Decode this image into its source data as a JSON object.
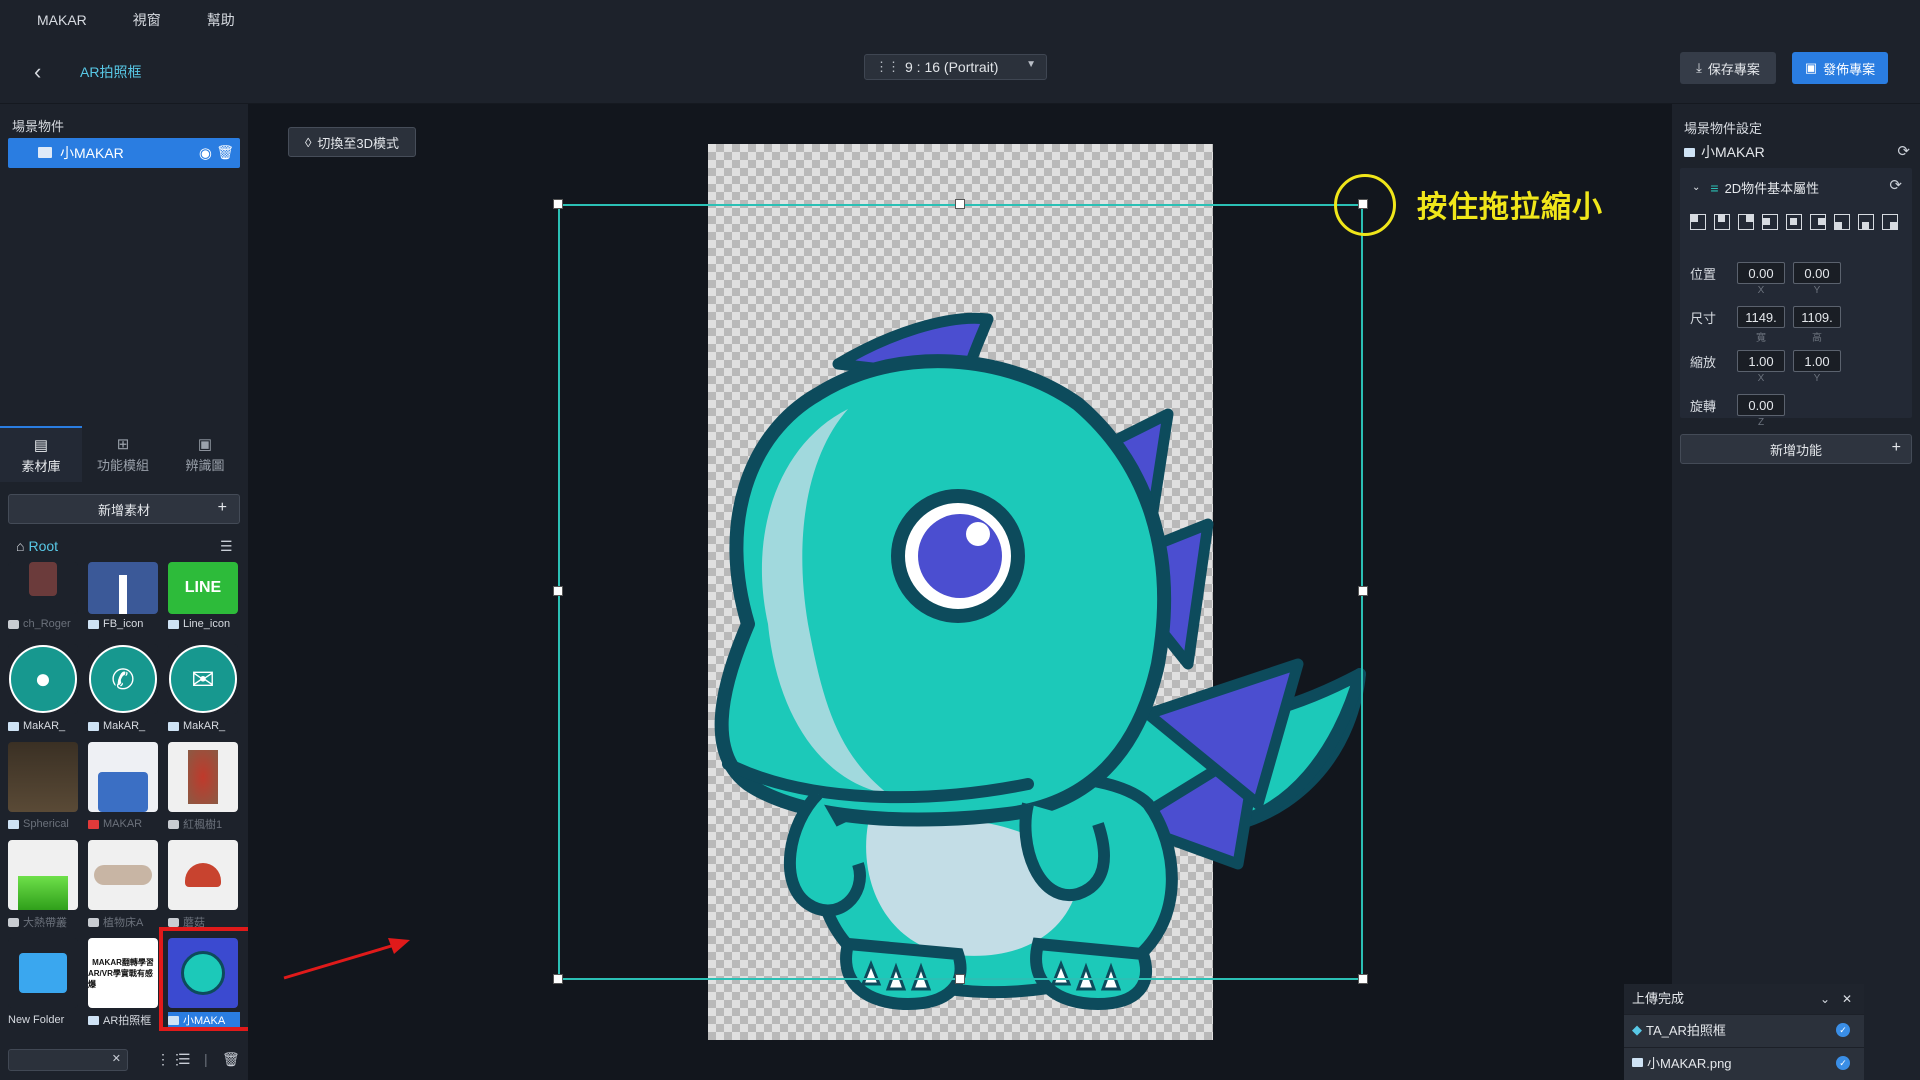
{
  "menu": {
    "items": [
      "MAKAR",
      "視窗",
      "幫助"
    ]
  },
  "toolbar": {
    "project_name": "AR拍照框",
    "ratio": "9 : 16 (Portrait)",
    "save_label": "保存專案",
    "publish_label": "發佈專案"
  },
  "scene_panel": {
    "title": "場景物件",
    "items": [
      {
        "label": "小MAKAR"
      }
    ]
  },
  "asset_tabs": [
    {
      "label": "素材庫",
      "active": true
    },
    {
      "label": "功能模組",
      "active": false
    },
    {
      "label": "辨識圖",
      "active": false
    }
  ],
  "assets": {
    "add_label": "新增素材",
    "root_label": "Root",
    "items": [
      {
        "label": "ch_Roger",
        "type": "cube",
        "dim": true
      },
      {
        "label": "FB_icon",
        "type": "image",
        "dim": false
      },
      {
        "label": "Line_icon",
        "type": "image",
        "dim": false
      },
      {
        "label": "MakAR_",
        "type": "image",
        "dim": false
      },
      {
        "label": "MakAR_",
        "type": "image",
        "dim": false
      },
      {
        "label": "MakAR_",
        "type": "image",
        "dim": false
      },
      {
        "label": "Spherical",
        "type": "image",
        "dim": true
      },
      {
        "label": "MAKAR",
        "type": "video",
        "dim": true
      },
      {
        "label": "紅楓樹1",
        "type": "cube",
        "dim": true
      },
      {
        "label": "大熱帶叢",
        "type": "cube",
        "dim": true
      },
      {
        "label": "植物床A",
        "type": "cube",
        "dim": true
      },
      {
        "label": "蘑菇",
        "type": "cube",
        "dim": true
      },
      {
        "label": "New Folder",
        "type": "folder",
        "dim": false
      },
      {
        "label": "AR拍照框",
        "type": "image",
        "dim": false
      },
      {
        "label": "小MAKA",
        "type": "image",
        "dim": false
      }
    ],
    "thumb_texts": {
      "line": "LINE",
      "makar_banner_1": "MAKAR翻轉學習",
      "makar_banner_2": "AR/VR學實戰有感爆"
    }
  },
  "canvas": {
    "switch_label": "切換至3D模式",
    "hint_text": "按住拖拉縮小"
  },
  "properties": {
    "title": "場景物件設定",
    "object_name": "小MAKAR",
    "section_title": "2D物件基本屬性",
    "position": {
      "label": "位置",
      "x": "0.00",
      "y": "0.00",
      "x_sub": "X",
      "y_sub": "Y"
    },
    "size": {
      "label": "尺寸",
      "w": "1149.",
      "h": "1109.",
      "w_sub": "寬",
      "h_sub": "高"
    },
    "scale": {
      "label": "縮放",
      "x": "1.00",
      "y": "1.00",
      "x_sub": "X",
      "y_sub": "Y"
    },
    "rotation": {
      "label": "旋轉",
      "z": "0.00",
      "z_sub": "Z"
    },
    "add_feature_label": "新增功能"
  },
  "upload": {
    "title": "上傳完成",
    "items": [
      "TA_AR拍照框",
      "小MAKAR.png"
    ]
  },
  "colors": {
    "accent": "#2a7de1",
    "teal": "#2bc0b5",
    "hint": "#f0e61a",
    "highlight": "#e01a1a"
  }
}
